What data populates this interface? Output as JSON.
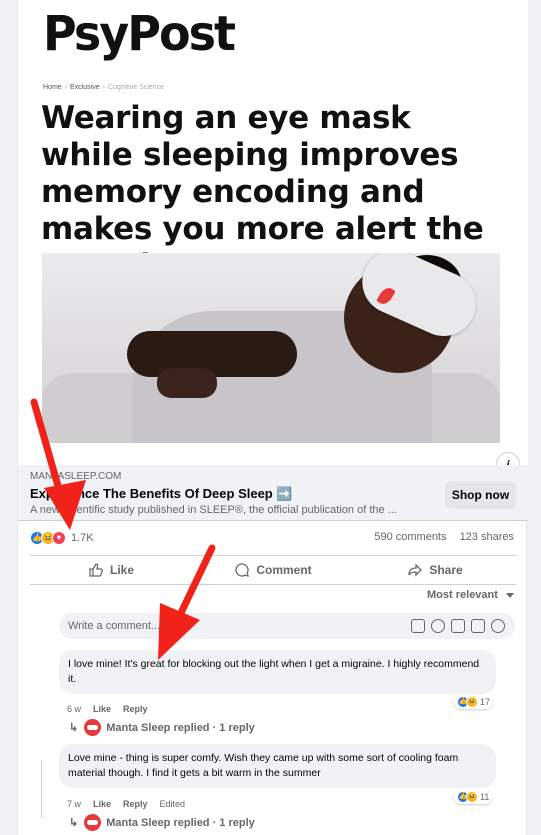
{
  "ad": {
    "brand": "PsyPost",
    "breadcrumb": [
      "Home",
      "Exclusive",
      "Cognitive Science"
    ],
    "headline": "Wearing an eye mask while sleeping improves memory encoding and makes you more alert the next day."
  },
  "link_preview": {
    "domain": "MANTASLEEP.COM",
    "title": "Experience The Benefits Of Deep Sleep ➡️",
    "subtitle": "A new scientific study published in SLEEP®, the official publication of the ...",
    "cta": "Shop now"
  },
  "engagement": {
    "reaction_count": "1.7K",
    "comments": "590 comments",
    "shares": "123 shares",
    "reaction_icons": [
      "like",
      "haha",
      "love"
    ]
  },
  "actions": {
    "like": "Like",
    "comment": "Comment",
    "share": "Share"
  },
  "sort_label": "Most relevant",
  "composer": {
    "placeholder": "Write a comment..."
  },
  "comments": [
    {
      "text": "I love mine! It's great for blocking out the light when I get a migraine. I highly recommend it.",
      "age": "6 w",
      "like": "Like",
      "reply": "Reply",
      "edited": "",
      "reaction_count": "17",
      "reply_summary": "Manta Sleep replied · 1 reply"
    },
    {
      "text": "Love mine - thing is super comfy. Wish they came up with some sort of cooling foam material though. I find it gets a bit warm in the summer",
      "age": "7 w",
      "like": "Like",
      "reply": "Reply",
      "edited": "Edited",
      "reaction_count": "11",
      "reply_summary": "Manta Sleep replied · 1 reply"
    }
  ],
  "colors": {
    "annotation_arrow": "#f0221a",
    "link_box_bg": "#f0f2f5",
    "secondary_text": "#65676b",
    "like_blue": "#1877f2"
  }
}
